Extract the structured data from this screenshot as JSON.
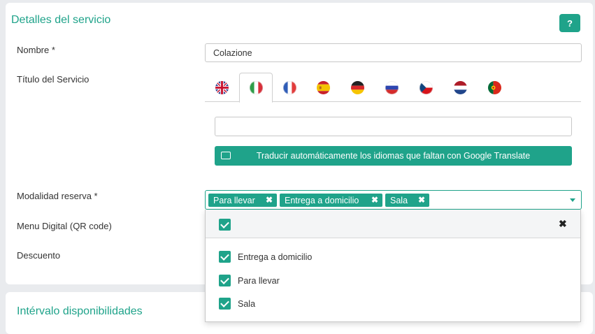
{
  "section": {
    "title": "Detalles del servicio",
    "help_label": "?"
  },
  "fields": {
    "nombre_label": "Nombre *",
    "nombre_value": "Colazione",
    "titulo_label": "Título del Servicio",
    "titulo_value": "",
    "modalidad_label": "Modalidad reserva *",
    "menu_label": "Menu Digital (QR code)",
    "descuento_label": "Descuento"
  },
  "languages": [
    {
      "code": "en",
      "icon": "uk-flag-icon"
    },
    {
      "code": "it",
      "icon": "italy-flag-icon",
      "active": true
    },
    {
      "code": "fr",
      "icon": "france-flag-icon"
    },
    {
      "code": "es",
      "icon": "spain-flag-icon"
    },
    {
      "code": "de",
      "icon": "germany-flag-icon"
    },
    {
      "code": "ru",
      "icon": "russia-flag-icon"
    },
    {
      "code": "cz",
      "icon": "czech-flag-icon"
    },
    {
      "code": "nl",
      "icon": "netherlands-flag-icon"
    },
    {
      "code": "pt",
      "icon": "portugal-flag-icon"
    }
  ],
  "translate_button": "Traducir automáticamente los idiomas que faltan con Google Translate",
  "selected_chips": [
    "Para llevar",
    "Entrega a domicilio",
    "Sala"
  ],
  "chip_remove": "✖",
  "dropdown": {
    "close_label": "✖",
    "options": [
      {
        "label": "Entrega a domicilio",
        "checked": true
      },
      {
        "label": "Para llevar",
        "checked": true
      },
      {
        "label": "Sala",
        "checked": true
      }
    ]
  },
  "section2": {
    "title": "Intérvalo disponibilidades"
  },
  "colors": {
    "accent": "#1fa38a",
    "background": "#e9ebee"
  }
}
